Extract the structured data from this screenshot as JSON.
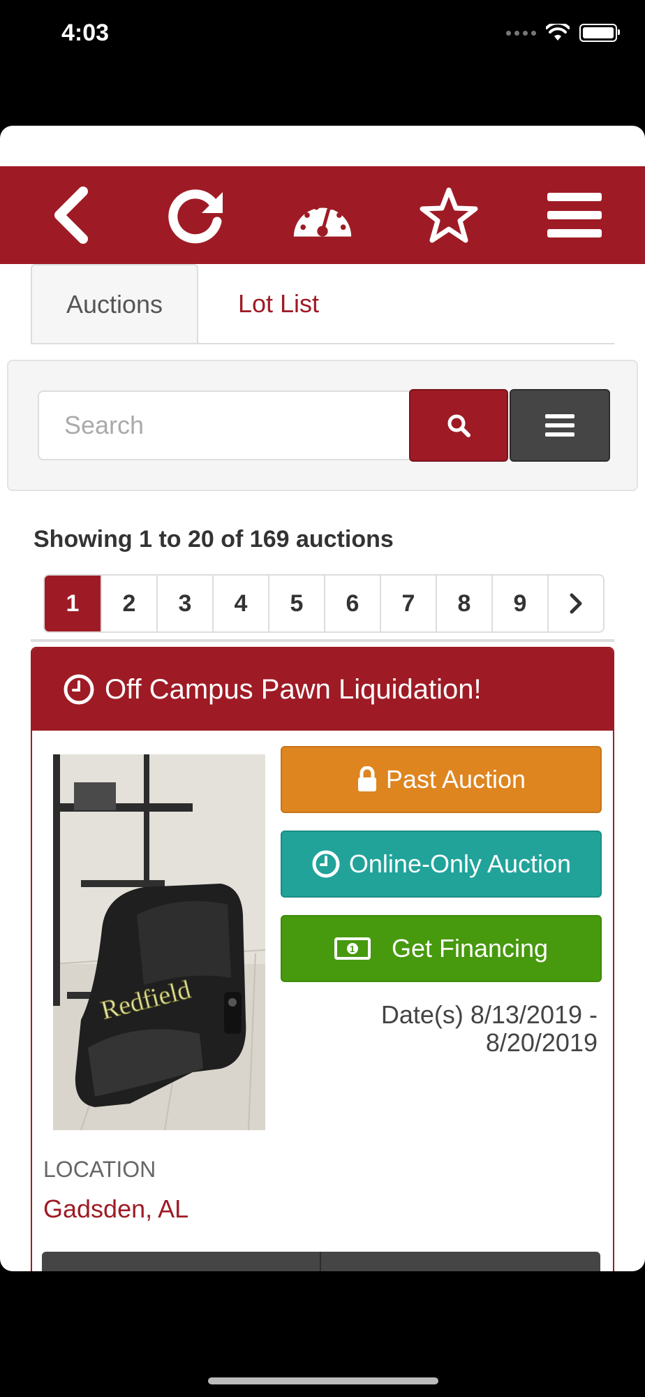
{
  "status": {
    "time": "4:03"
  },
  "toolbar": {
    "back_icon": "chevron-left-icon",
    "refresh_icon": "refresh-icon",
    "dashboard_icon": "dashboard-gauge-icon",
    "favorites_icon": "star-icon",
    "menu_icon": "hamburger-menu-icon"
  },
  "tabs": [
    {
      "label": "Auctions",
      "active": true
    },
    {
      "label": "Lot List",
      "active": false
    }
  ],
  "search": {
    "placeholder": "Search",
    "value": ""
  },
  "results": {
    "summary": "Showing 1 to 20 of 169 auctions"
  },
  "pagination": {
    "pages": [
      "1",
      "2",
      "3",
      "4",
      "5",
      "6",
      "7",
      "8",
      "9"
    ],
    "current": "1",
    "next_icon": "chevron-right-icon"
  },
  "auction": {
    "title": "Off Campus Pawn Liquidation!",
    "image_watermark": "Redfield",
    "past_label": "Past Auction",
    "online_label": "Online-Only Auction",
    "financing_label": "Get Financing",
    "dates": "Date(s) 8/13/2019 - 8/20/2019",
    "location_label": "LOCATION",
    "location_value": "Gadsden, AL"
  },
  "colors": {
    "brand": "#9e1b25",
    "past": "#de8520",
    "online": "#21a39a",
    "financing": "#47990e",
    "dark_button": "#454545"
  }
}
